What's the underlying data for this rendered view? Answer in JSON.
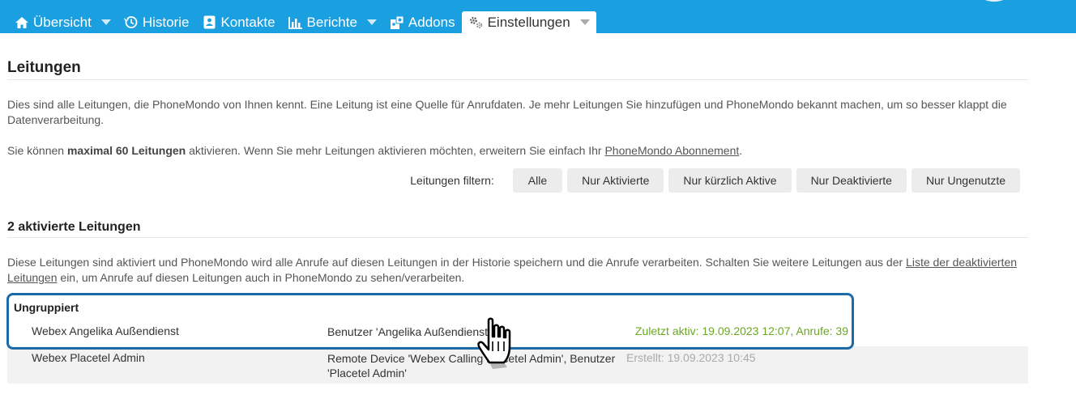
{
  "nav": {
    "tabs": [
      {
        "label": "Übersicht",
        "icon": "home-icon",
        "dropdown": true
      },
      {
        "label": "Historie",
        "icon": "history-icon",
        "dropdown": false
      },
      {
        "label": "Kontakte",
        "icon": "contacts-icon",
        "dropdown": false
      },
      {
        "label": "Berichte",
        "icon": "bar-chart-icon",
        "dropdown": true
      },
      {
        "label": "Addons",
        "icon": "puzzle-icon",
        "dropdown": false
      },
      {
        "label": "Einstellungen",
        "icon": "gears-icon",
        "dropdown": true,
        "active": true
      }
    ]
  },
  "page": {
    "title": "Leitungen",
    "intro": "Dies sind alle Leitungen, die PhoneMondo von Ihnen kennt. Eine Leitung ist eine Quelle für Anrufdaten. Je mehr Leitungen Sie hinzufügen und PhoneMondo bekannt machen, um so besser klappt die Datenverarbeitung.",
    "limit_prefix": "Sie können ",
    "limit_bold": "maximal 60 Leitungen",
    "limit_middle": " aktivieren. Wenn Sie mehr Leitungen aktivieren möchten, erweitern Sie einfach Ihr ",
    "limit_link": "PhoneMondo Abonnement",
    "limit_suffix": "."
  },
  "filter": {
    "label": "Leitungen filtern:",
    "buttons": [
      "Alle",
      "Nur Aktivierte",
      "Nur kürzlich Aktive",
      "Nur Deaktivierte",
      "Nur Ungenutzte"
    ]
  },
  "section": {
    "title": "2 aktivierte Leitungen",
    "desc_prefix": "Diese Leitungen sind aktiviert und PhoneMondo wird alle Anrufe auf diesen Leitungen in der Historie speichern und die Anrufe verarbeiten. Schalten Sie weitere Leitungen aus der ",
    "desc_link": "Liste der deaktivierten Leitungen",
    "desc_suffix": " ein, um Anrufe auf diesen Leitungen auch in PhoneMondo zu sehen/verarbeiten."
  },
  "group": {
    "title": "Ungruppiert",
    "lines": [
      {
        "name": "Webex Angelika Außendienst",
        "desc": "Benutzer 'Angelika Außendienst'",
        "status": "Zuletzt aktiv: 19.09.2023 12:07, Anrufe: 39"
      },
      {
        "name": "Webex Placetel Admin",
        "desc": "Remote Device 'Webex Calling Placetel Admin', Benutzer 'Placetel Admin'",
        "status": "Erstellt: 19.09.2023 10:45"
      }
    ]
  },
  "colors": {
    "topbar": "#1aa0e0",
    "highlight_border": "#1c6aa6",
    "active_status": "#6aa821",
    "inactive_status": "#aaaaaa"
  }
}
